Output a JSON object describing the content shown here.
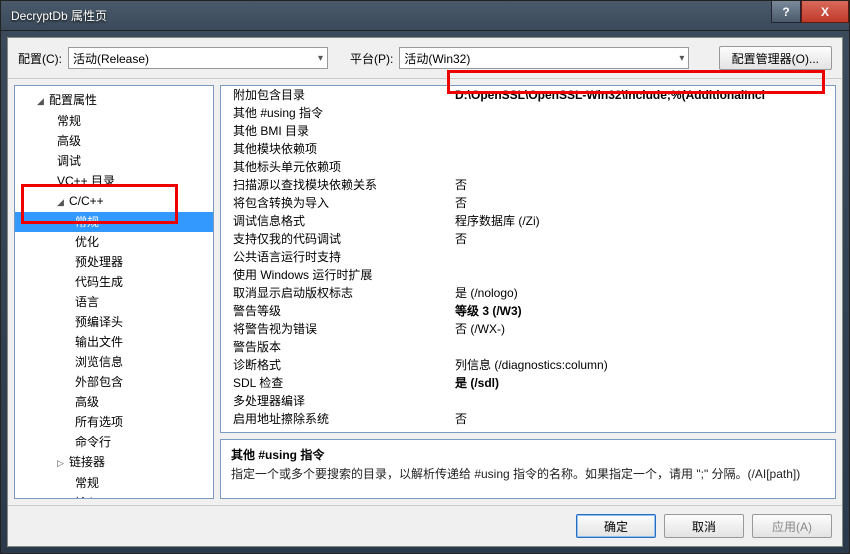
{
  "window": {
    "title": "DecryptDb 属性页",
    "help": "?",
    "close": "X"
  },
  "toprow": {
    "config_label": "配置(C):",
    "config_value": "活动(Release)",
    "platform_label": "平台(P):",
    "platform_value": "活动(Win32)",
    "cfgmgr": "配置管理器(O)..."
  },
  "tree": [
    {
      "lvl": 1,
      "txt": "配置属性",
      "exp": true
    },
    {
      "lvl": 2,
      "txt": "常规"
    },
    {
      "lvl": 2,
      "txt": "高级"
    },
    {
      "lvl": 2,
      "txt": "调试"
    },
    {
      "lvl": 2,
      "txt": "VC++ 目录"
    },
    {
      "lvl": 2,
      "txt": "C/C++",
      "exp": true
    },
    {
      "lvl": 3,
      "txt": "常规",
      "sel": true
    },
    {
      "lvl": 3,
      "txt": "优化"
    },
    {
      "lvl": 3,
      "txt": "预处理器"
    },
    {
      "lvl": 3,
      "txt": "代码生成"
    },
    {
      "lvl": 3,
      "txt": "语言"
    },
    {
      "lvl": 3,
      "txt": "预编译头"
    },
    {
      "lvl": 3,
      "txt": "输出文件"
    },
    {
      "lvl": 3,
      "txt": "浏览信息"
    },
    {
      "lvl": 3,
      "txt": "外部包含"
    },
    {
      "lvl": 3,
      "txt": "高级"
    },
    {
      "lvl": 3,
      "txt": "所有选项"
    },
    {
      "lvl": 3,
      "txt": "命令行"
    },
    {
      "lvl": 2,
      "txt": "链接器",
      "col": true
    },
    {
      "lvl": 3,
      "txt": "常规"
    },
    {
      "lvl": 3,
      "txt": "输入"
    }
  ],
  "props": [
    {
      "k": "附加包含目录",
      "v": "D:\\OpenSSL\\OpenSSL-Win32\\include;%(AdditionalIncl",
      "bold": true
    },
    {
      "k": "其他 #using 指令",
      "v": ""
    },
    {
      "k": "其他 BMI 目录",
      "v": ""
    },
    {
      "k": "其他模块依赖项",
      "v": ""
    },
    {
      "k": "其他标头单元依赖项",
      "v": ""
    },
    {
      "k": "扫描源以查找模块依赖关系",
      "v": "否"
    },
    {
      "k": "将包含转换为导入",
      "v": "否"
    },
    {
      "k": "调试信息格式",
      "v": "程序数据库 (/Zi)"
    },
    {
      "k": "支持仅我的代码调试",
      "v": "否"
    },
    {
      "k": "公共语言运行时支持",
      "v": ""
    },
    {
      "k": "使用 Windows 运行时扩展",
      "v": ""
    },
    {
      "k": "取消显示启动版权标志",
      "v": "是 (/nologo)"
    },
    {
      "k": "警告等级",
      "v": "等级 3 (/W3)",
      "bold": true
    },
    {
      "k": "将警告视为错误",
      "v": "否 (/WX-)"
    },
    {
      "k": "警告版本",
      "v": ""
    },
    {
      "k": "诊断格式",
      "v": "列信息 (/diagnostics:column)"
    },
    {
      "k": "SDL 检查",
      "v": "是 (/sdl)",
      "bold": true
    },
    {
      "k": "多处理器编译",
      "v": ""
    },
    {
      "k": "启用地址擦除系统",
      "v": "否"
    }
  ],
  "desc": {
    "title": "其他 #using 指令",
    "body": "指定一个或多个要搜索的目录，以解析传递给 #using 指令的名称。如果指定一个，请用 \";\" 分隔。(/AI[path])"
  },
  "buttons": {
    "ok": "确定",
    "cancel": "取消",
    "apply": "应用(A)"
  }
}
